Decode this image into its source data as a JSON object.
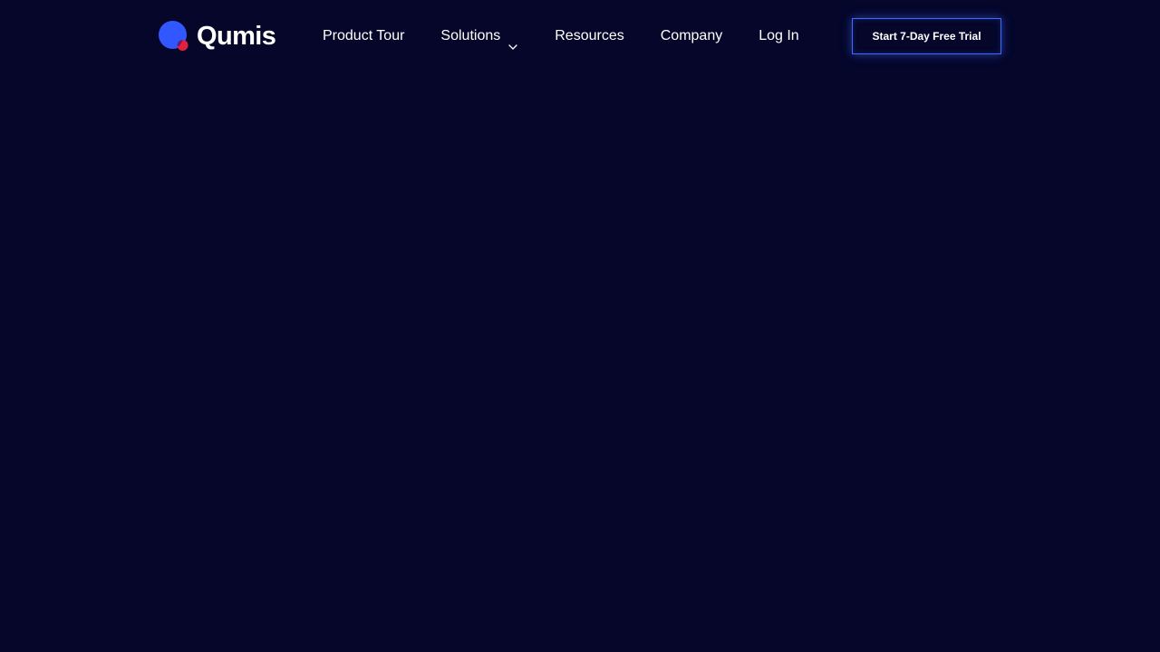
{
  "brand": {
    "name": "Qumis",
    "logo_icon": "qumis-logo-icon",
    "colors": {
      "primary": "#3157ff",
      "accent": "#e0213f"
    }
  },
  "nav": {
    "items": [
      {
        "label": "Product Tour"
      },
      {
        "label": "Solutions",
        "has_dropdown": true,
        "icon": "chevron-down-icon"
      },
      {
        "label": "Resources"
      },
      {
        "label": "Company"
      },
      {
        "label": "Log In"
      }
    ]
  },
  "cta": {
    "label": "Start 7-Day Free Trial",
    "border_color": "#3f6cff"
  },
  "theme": {
    "background": "#05062a",
    "text": "#ffffff"
  }
}
